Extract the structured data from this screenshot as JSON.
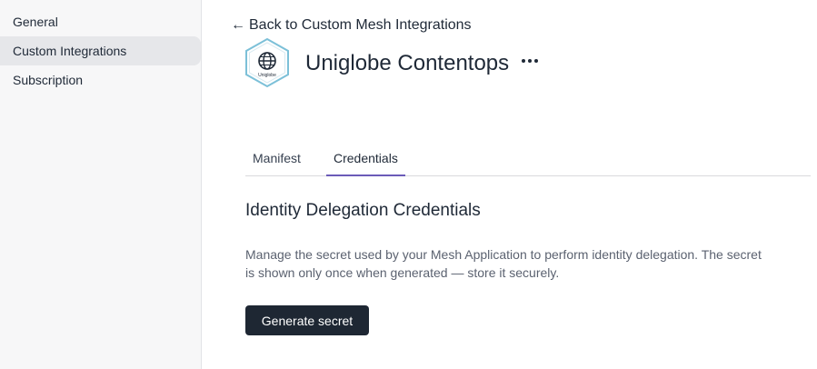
{
  "sidebar": {
    "items": [
      {
        "label": "General"
      },
      {
        "label": "Custom Integrations",
        "active": true
      },
      {
        "label": "Subscription"
      }
    ]
  },
  "header": {
    "back_link": "Back to Custom Mesh Integrations",
    "back_icon": "arrow-left-icon",
    "app_name": "Uniglobe Contentops",
    "logo_icon": "globe-hexagon-icon",
    "logo_text": "Uniglobe",
    "more_icon": "more-horizontal-icon"
  },
  "tabs": [
    {
      "label": "Manifest"
    },
    {
      "label": "Credentials",
      "active": true
    }
  ],
  "content": {
    "title": "Identity Delegation Credentials",
    "description": "Manage the secret used by your Mesh Application to perform identity delegation. The secret is shown only once when generated — store it securely.",
    "button_label": "Generate secret"
  },
  "colors": {
    "sidebar_bg": "#f7f7f8",
    "active_nav_bg": "#e6e7ea",
    "tab_accent": "#6b5bb8",
    "primary_button_bg": "#1e2733",
    "logo_stroke": "#7cc0d8"
  }
}
